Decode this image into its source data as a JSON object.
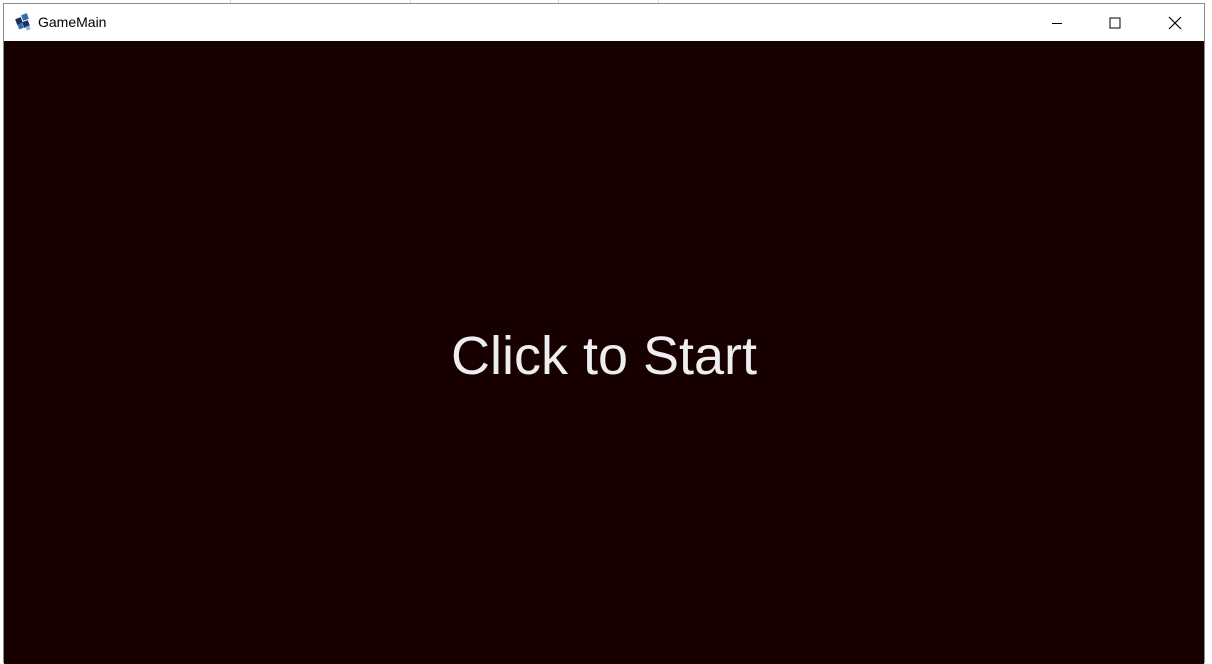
{
  "window": {
    "title": "GameMain",
    "controls": {
      "minimize": "minimize",
      "maximize": "maximize",
      "close": "close"
    }
  },
  "game": {
    "prompt": "Click to Start",
    "background_color": "#160000",
    "text_color": "#eeeeee"
  },
  "icons": {
    "app": "java-duke-icon",
    "minimize": "minimize-icon",
    "maximize": "maximize-icon",
    "close": "close-icon"
  }
}
